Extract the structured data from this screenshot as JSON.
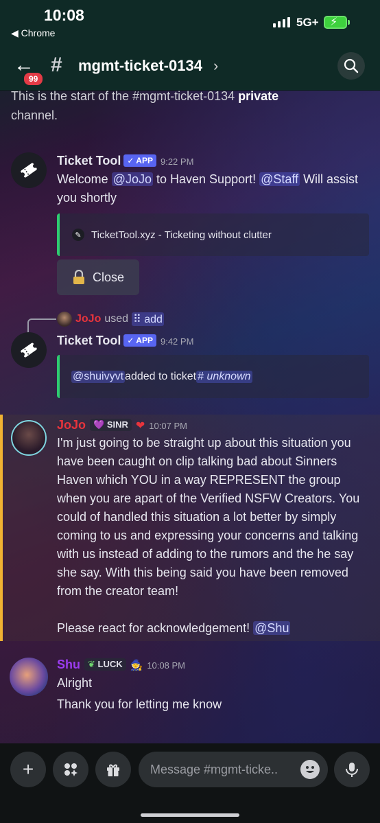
{
  "status_bar": {
    "time": "10:08",
    "back_app": "◀ Chrome",
    "network": "5G+"
  },
  "header": {
    "badge": "99",
    "channel": "mgmt-ticket-0134",
    "chevron": "›"
  },
  "channel_start": {
    "prefix": "This is the start of the #mgmt-ticket-0134 ",
    "bold": "private",
    "suffix": "channel."
  },
  "messages": [
    {
      "author": "Ticket Tool",
      "tag": "✓ APP",
      "time": "9:22 PM",
      "text_1": "Welcome ",
      "mention_1": "@JoJo",
      "text_2": " to Haven Support! ",
      "mention_2": "@Staff",
      "text_3": " Will assist you shortly",
      "embed": "TicketTool.xyz - Ticketing without clutter",
      "button": "Close"
    },
    {
      "reply_user": "JoJo",
      "reply_verb": "used",
      "reply_cmd": "add",
      "author": "Ticket Tool",
      "tag": "✓ APP",
      "time": "9:42 PM",
      "embed_mention": "@shuivyvt",
      "embed_text": " added to ticket ",
      "embed_channel": "unknown"
    },
    {
      "author": "JoJo",
      "role": "SINR",
      "time": "10:07 PM",
      "text": "I'm just going to be straight up about this situation you have been caught on clip talking bad about Sinners Haven which YOU in a way REPRESENT the group when you are apart of the Verified NSFW Creators. You could of handled this situation a lot better by simply coming to us and expressing your concerns and talking with us instead of adding to the rumors and the he say she say. With this being said you have been removed from the creator team!",
      "text_2": "Please react for acknowledgement! ",
      "mention": "@Shu"
    },
    {
      "author": "Shu",
      "role": "LUCK",
      "time": "10:08 PM",
      "line_1": "Alright",
      "line_2": "Thank you for letting me know"
    }
  ],
  "composer": {
    "placeholder": "Message #mgmt-ticke.."
  },
  "colors": {
    "jojo": "#e8343c",
    "shu": "#9b3cf0",
    "app_tag": "#5865f2",
    "embed_accent": "#2ecc71",
    "highlight": "#f0b232"
  }
}
